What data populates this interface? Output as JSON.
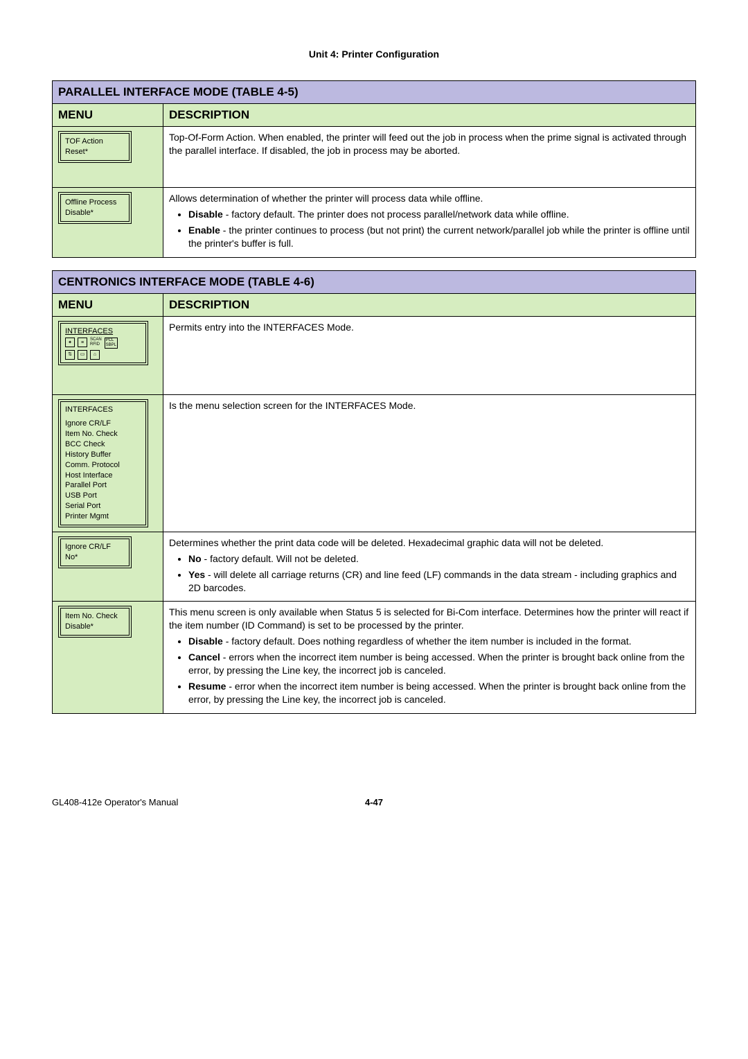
{
  "unit_header": "Unit 4: Printer Configuration",
  "table45": {
    "title": "PARALLEL INTERFACE MODE (TABLE 4-5)",
    "col_menu": "MENU",
    "col_desc": "DESCRIPTION",
    "rows": [
      {
        "lcd": [
          "TOF Action",
          "Reset*"
        ],
        "desc_intro": "Top-Of-Form Action. When enabled, the printer will feed out the job in process when the prime signal is activated through the parallel interface. If disabled, the job in process may be aborted.",
        "bullets": []
      },
      {
        "lcd": [
          "Offline Process",
          "Disable*"
        ],
        "desc_intro": "Allows determination of whether the printer will process data while offline.",
        "bullets": [
          {
            "bold": "Disable",
            "text": " - factory default. The printer does not process parallel/network data while offline."
          },
          {
            "bold": "Enable",
            "text": " - the printer continues to process (but not print) the current network/parallel job while the printer is offline until the printer's buffer is full."
          }
        ]
      }
    ]
  },
  "table46": {
    "title": "CENTRONICS INTERFACE MODE (TABLE 4-6)",
    "col_menu": "MENU",
    "col_desc": "DESCRIPTION",
    "rows": [
      {
        "lcd_title": "INTERFACES",
        "show_icons": true,
        "desc_intro": "Permits entry into the INTERFACES Mode.",
        "bullets": []
      },
      {
        "lcd_header": "INTERFACES",
        "lcd_lines": [
          "Ignore CR/LF",
          "Item No. Check",
          "BCC Check",
          "History Buffer",
          "Comm. Protocol",
          "Host Interface",
          "Parallel Port",
          "USB Port",
          "Serial Port",
          "Printer Mgmt"
        ],
        "desc_intro": "Is the menu selection screen for the INTERFACES Mode.",
        "bullets": []
      },
      {
        "lcd": [
          "Ignore CR/LF",
          "No*"
        ],
        "desc_intro": "Determines whether the print data code will be deleted. Hexadecimal graphic data will not be deleted.",
        "bullets": [
          {
            "bold": "No",
            "text": " - factory default. Will not be deleted."
          },
          {
            "bold": "Yes",
            "text": " - will delete all carriage returns (CR) and line feed (LF) commands in the data stream - including graphics and 2D barcodes."
          }
        ]
      },
      {
        "lcd": [
          "Item No. Check",
          "Disable*"
        ],
        "desc_intro": "This menu screen is only available when Status 5 is selected for Bi-Com interface. Determines how the printer will react if the item number (ID Command) is set to be processed by the printer.",
        "bullets": [
          {
            "bold": "Disable",
            "text": " - factory default. Does nothing regardless of whether the item number is included in the format."
          },
          {
            "bold": "Cancel",
            "text": " - errors when the incorrect item number is being accessed. When the printer is brought back online from the error, by pressing the Line key, the incorrect job is canceled."
          },
          {
            "bold": "Resume",
            "text": " - error when the incorrect item number is being accessed. When the printer is brought back online from the error, by pressing the Line key, the incorrect job is canceled."
          }
        ]
      }
    ]
  },
  "footer": {
    "left": "GL408-412e Operator's Manual",
    "page": "4-47"
  },
  "icon_labels": [
    "SCAN",
    "RFID",
    "PCL",
    "SBPL"
  ]
}
